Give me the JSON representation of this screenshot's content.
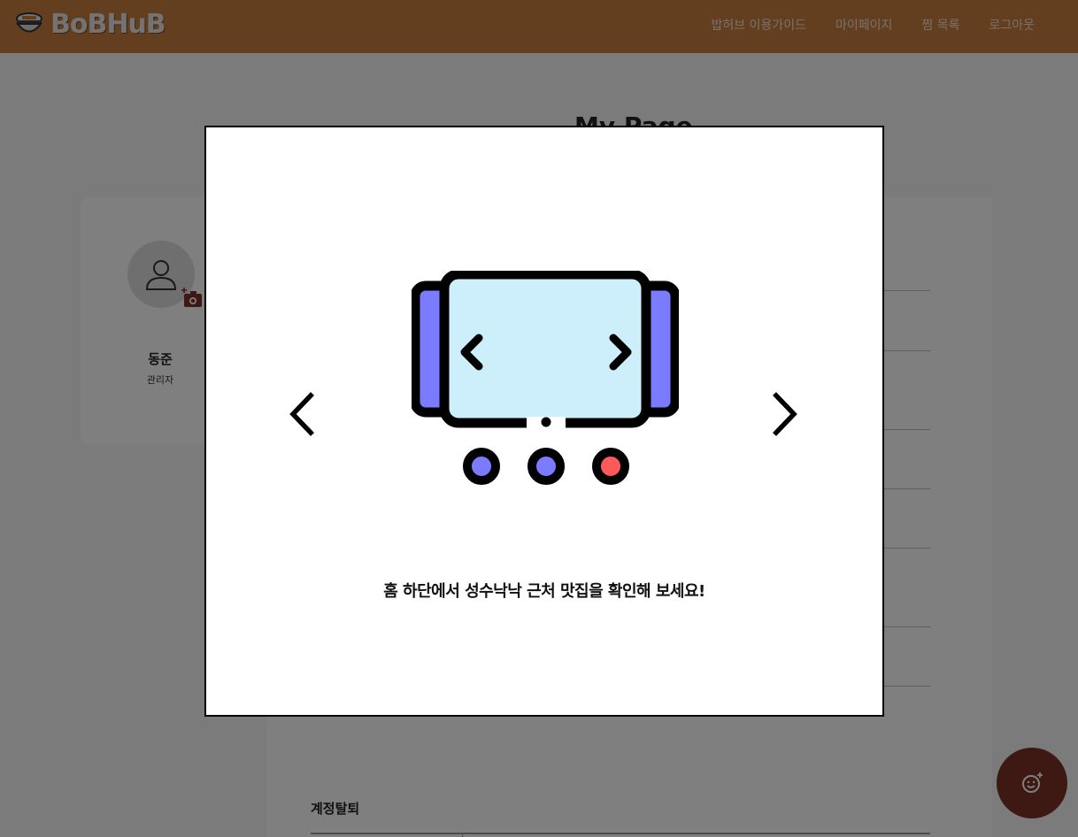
{
  "header": {
    "logo_text": "BoBHuB",
    "nav": [
      "밥허브 이용가이드",
      "마이페이지",
      "찜 목록",
      "로그아웃"
    ]
  },
  "page": {
    "title": "My Page"
  },
  "profile": {
    "name": "동준",
    "role": "관리자"
  },
  "account": {
    "delete_title": "계정탈퇴"
  },
  "modal": {
    "guide_text": "홈 하단에서 성수낙낙 근처 맛집을 확인해 보세요!",
    "illustration": "carousel-slider-illustration",
    "dots": [
      {
        "color": "#7b7bff",
        "active": false
      },
      {
        "color": "#7b7bff",
        "active": false
      },
      {
        "color": "#ff5a5a",
        "active": true
      }
    ]
  },
  "colors": {
    "header_bg": "#c77f3e",
    "fab_bg": "#7d3326",
    "slide_bg": "#cdeffb",
    "side_slide": "#7b7bff"
  },
  "icons": {
    "fab": "smile-plus-icon",
    "camera": "camera-plus-icon",
    "avatar": "user-icon"
  }
}
